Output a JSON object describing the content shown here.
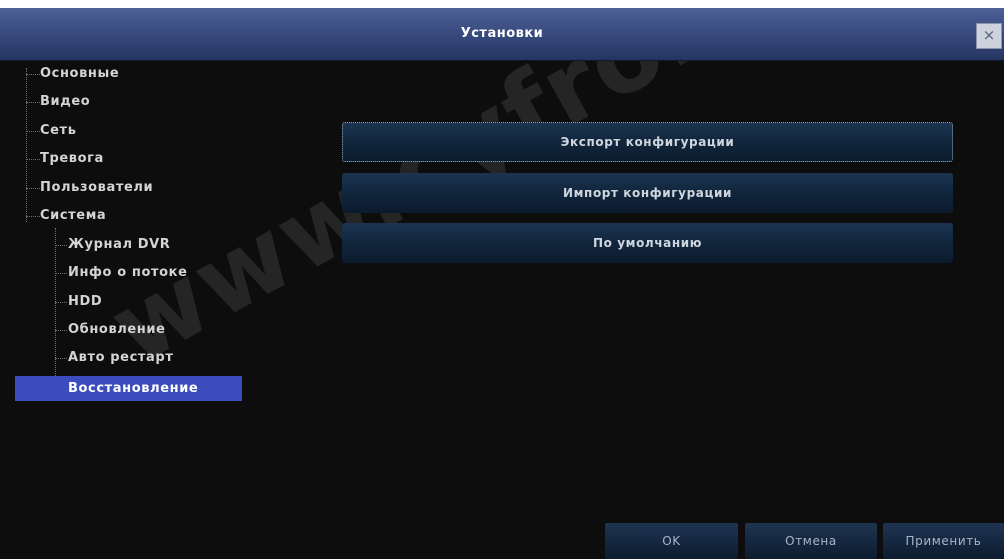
{
  "window": {
    "title": "Установки",
    "close_label": "×"
  },
  "menu": {
    "items": [
      {
        "label": "Основные"
      },
      {
        "label": "Видео"
      },
      {
        "label": "Сеть"
      },
      {
        "label": "Тревога"
      },
      {
        "label": "Пользователи"
      },
      {
        "label": "Система"
      }
    ],
    "subitems": [
      {
        "label": "Журнал DVR"
      },
      {
        "label": "Инфо о потоке"
      },
      {
        "label": "HDD"
      },
      {
        "label": "Обновление"
      },
      {
        "label": "Авто рестарт"
      },
      {
        "label": "Восстановление",
        "selected": true
      }
    ]
  },
  "actions": {
    "export_label": "Экспорт конфигурации",
    "import_label": "Импорт конфигурации",
    "default_label": "По умолчанию"
  },
  "footer": {
    "ok_label": "OK",
    "cancel_label": "Отмена",
    "apply_label": "Применить"
  },
  "watermark": "www.cyfron.ru",
  "colors": {
    "titlebar": "#3a4c80",
    "selection": "#3b4dbd",
    "button": "#11263d",
    "background": "#0d0d0d"
  }
}
